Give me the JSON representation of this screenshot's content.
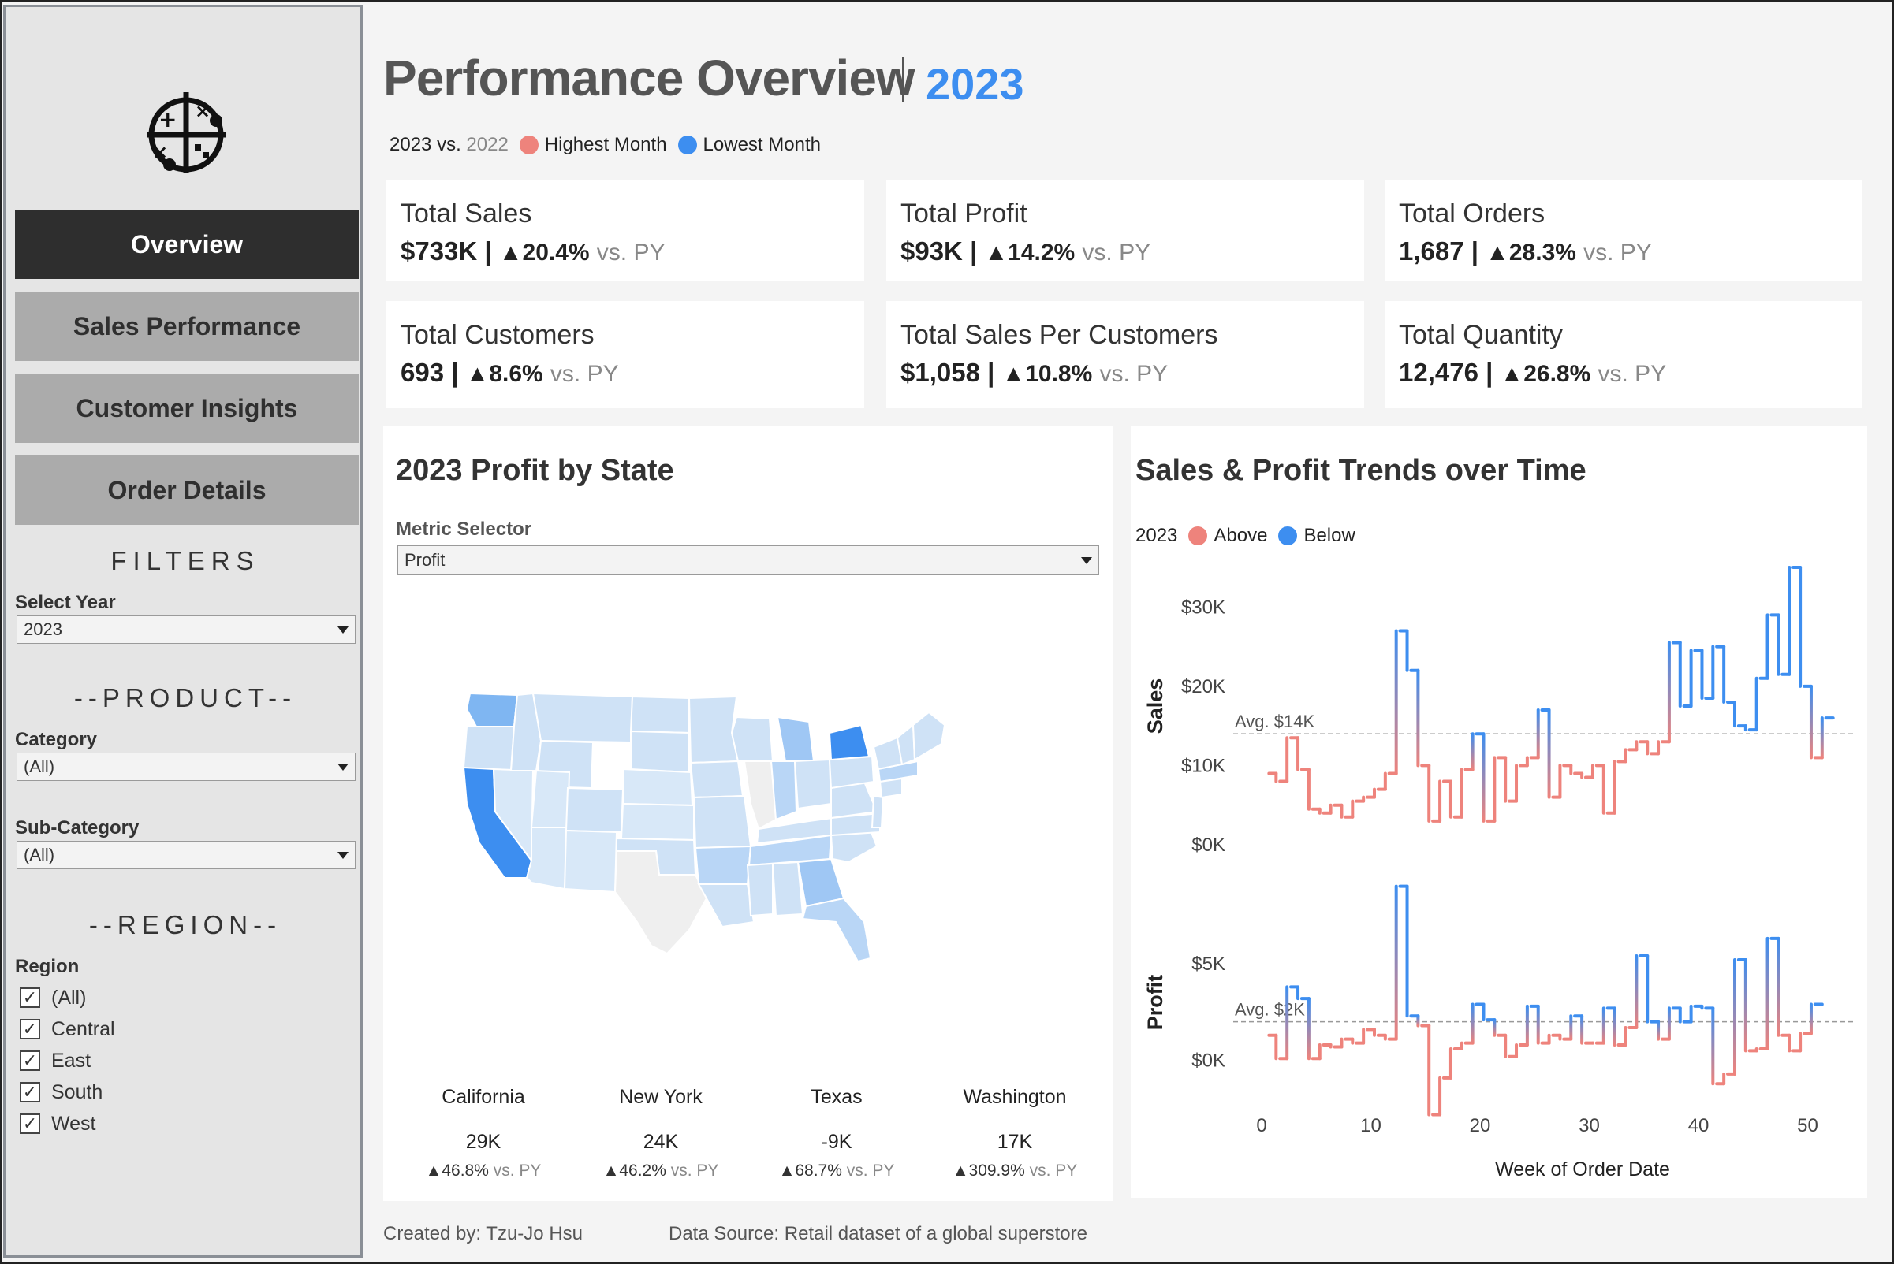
{
  "sidebar": {
    "nav": [
      "Overview",
      "Sales Performance",
      "Customer Insights",
      "Order Details"
    ],
    "filters_title": "FILTERS",
    "select_year_label": "Select Year",
    "select_year_value": "2023",
    "product_title": "--PRODUCT--",
    "category_label": "Category",
    "category_value": "(All)",
    "subcategory_label": "Sub-Category",
    "subcategory_value": "(All)",
    "region_title": "--REGION--",
    "region_label": "Region",
    "regions": [
      "(All)",
      "Central",
      "East",
      "South",
      "West"
    ]
  },
  "header": {
    "title": "Performance Overview",
    "year": "2023",
    "legend_current": "2023",
    "legend_vs": "vs.",
    "legend_prev": "2022",
    "legend_high": "Highest Month",
    "legend_low": "Lowest Month"
  },
  "kpis": [
    {
      "title": "Total Sales",
      "value": "$733K",
      "change": "20.4%",
      "suffix": "vs. PY"
    },
    {
      "title": "Total Profit",
      "value": "$93K",
      "change": "14.2%",
      "suffix": "vs. PY"
    },
    {
      "title": "Total Orders",
      "value": "1,687",
      "change": "28.3%",
      "suffix": "vs. PY"
    },
    {
      "title": "Total Customers",
      "value": "693",
      "change": "8.6%",
      "suffix": "vs. PY"
    },
    {
      "title": "Total Sales Per Customers",
      "value": "$1,058",
      "change": "10.8%",
      "suffix": "vs. PY"
    },
    {
      "title": "Total Quantity",
      "value": "12,476",
      "change": "26.8%",
      "suffix": "vs. PY"
    }
  ],
  "map_panel": {
    "title": "2023 Profit by State",
    "metric_label": "Metric Selector",
    "metric_value": "Profit",
    "states": [
      {
        "name": "California",
        "value": "29K",
        "change": "46.8%",
        "suffix": "vs. PY"
      },
      {
        "name": "New York",
        "value": "24K",
        "change": "46.2%",
        "suffix": "vs. PY"
      },
      {
        "name": "Texas",
        "value": "-9K",
        "change": "68.7%",
        "suffix": "vs. PY"
      },
      {
        "name": "Washington",
        "value": "17K",
        "change": "309.9%",
        "suffix": "vs. PY"
      }
    ]
  },
  "trend_panel": {
    "title": "Sales & Profit Trends over Time",
    "legend_year": "2023",
    "legend_above": "Above",
    "legend_below": "Below"
  },
  "colors": {
    "above": "#ee837c",
    "below": "#3d8ef0",
    "accent": "#3d8ef0"
  },
  "chart_data": [
    {
      "type": "line",
      "ylabel": "Sales",
      "xlabel": "Week of Order Date",
      "x": [
        1,
        2,
        3,
        4,
        5,
        6,
        7,
        8,
        9,
        10,
        11,
        12,
        13,
        14,
        15,
        16,
        17,
        18,
        19,
        20,
        21,
        22,
        23,
        24,
        25,
        26,
        27,
        28,
        29,
        30,
        31,
        32,
        33,
        34,
        35,
        36,
        37,
        38,
        39,
        40,
        41,
        42,
        43,
        44,
        45,
        46,
        47,
        48,
        49,
        50,
        51,
        52
      ],
      "values": [
        9000,
        8000,
        13500,
        9500,
        4500,
        4000,
        5000,
        3500,
        5500,
        6000,
        7000,
        9000,
        27000,
        22000,
        10000,
        3000,
        8000,
        3500,
        9500,
        14000,
        3000,
        11000,
        5500,
        10000,
        11000,
        17000,
        6000,
        10000,
        9000,
        8500,
        10000,
        4000,
        10500,
        12000,
        13000,
        11500,
        13000,
        25500,
        17500,
        24500,
        18500,
        25000,
        18000,
        15000,
        14500,
        21000,
        29000,
        21500,
        35000,
        20000,
        11000,
        16000
      ],
      "avg": 14000,
      "avg_label": "Avg. $14K",
      "yticks": [
        "$0K",
        "$10K",
        "$20K",
        "$30K"
      ],
      "ylim": [
        0,
        35000
      ],
      "legend": [
        "Above",
        "Below"
      ]
    },
    {
      "type": "line",
      "ylabel": "Profit",
      "xlabel": "Week of Order Date",
      "x": [
        1,
        2,
        3,
        4,
        5,
        6,
        7,
        8,
        9,
        10,
        11,
        12,
        13,
        14,
        15,
        16,
        17,
        18,
        19,
        20,
        21,
        22,
        23,
        24,
        25,
        26,
        27,
        28,
        29,
        30,
        31,
        32,
        33,
        34,
        35,
        36,
        37,
        38,
        39,
        40,
        41,
        42,
        43,
        44,
        45,
        46,
        47,
        48,
        49,
        50,
        51,
        52
      ],
      "values": [
        1300,
        100,
        3800,
        3200,
        100,
        800,
        700,
        1100,
        900,
        1600,
        1300,
        1100,
        9000,
        2300,
        1800,
        -2800,
        -900,
        600,
        900,
        2900,
        2100,
        1300,
        200,
        800,
        2800,
        900,
        1300,
        1100,
        2300,
        900,
        900,
        2700,
        800,
        1700,
        5400,
        2000,
        1100,
        2700,
        2000,
        2800,
        2700,
        -1200,
        -700,
        5200,
        500,
        600,
        6300,
        1300,
        500,
        1400,
        2900
      ],
      "avg": 2000,
      "avg_label": "Avg. $2K",
      "yticks": [
        "$0K",
        "$5K"
      ],
      "ylim": [
        -4000,
        10000
      ],
      "xticks": [
        "0",
        "10",
        "20",
        "30",
        "40",
        "50"
      ]
    }
  ],
  "footer": {
    "created_by": "Created by: Tzu-Jo Hsu",
    "data_source": "Data Source: Retail dataset of a global superstore"
  }
}
